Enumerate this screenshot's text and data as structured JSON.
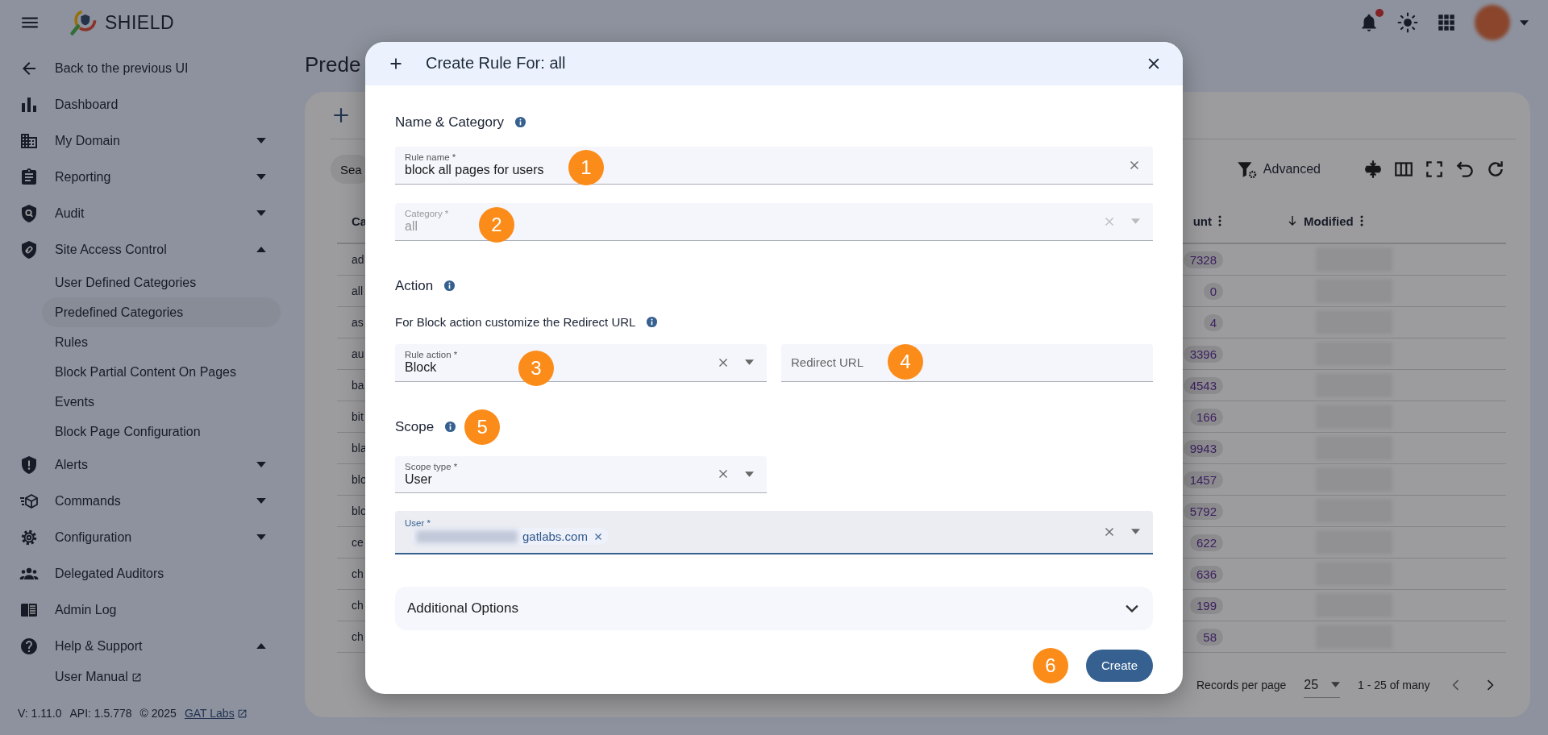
{
  "top_bar": {
    "app_name": "SHIELD",
    "notification_dot": true
  },
  "sidebar": {
    "back_link": "Back to the previous UI",
    "items": [
      {
        "label": "Dashboard"
      },
      {
        "label": "My Domain",
        "expanded": false
      },
      {
        "label": "Reporting",
        "expanded": false
      },
      {
        "label": "Audit",
        "expanded": false
      },
      {
        "label": "Site Access Control",
        "expanded": true,
        "children": [
          {
            "label": "User Defined Categories",
            "selected": false
          },
          {
            "label": "Predefined Categories",
            "selected": true
          },
          {
            "label": "Rules",
            "selected": false
          },
          {
            "label": "Block Partial Content On Pages",
            "selected": false
          },
          {
            "label": "Events",
            "selected": false
          },
          {
            "label": "Block Page Configuration",
            "selected": false
          }
        ]
      },
      {
        "label": "Alerts",
        "expanded": false
      },
      {
        "label": "Commands",
        "expanded": false
      },
      {
        "label": "Configuration",
        "expanded": false
      },
      {
        "label": "Delegated Auditors"
      },
      {
        "label": "Admin Log"
      },
      {
        "label": "Help & Support",
        "expanded": true,
        "children": [
          {
            "label": "User Manual",
            "selected": false,
            "external": true
          }
        ]
      }
    ],
    "footer": {
      "version": "V: 1.11.0",
      "api": "API: 1.5.778",
      "copyright": "© 2025",
      "link": "GAT Labs"
    }
  },
  "page": {
    "title": "Prede",
    "search_placeholder": "Sea",
    "advanced_button": "Advanced",
    "table": {
      "columns": [
        {
          "label": "Ca"
        },
        {
          "label": "unt"
        },
        {
          "label": "Modified",
          "sort_descending": true
        }
      ],
      "rows": [
        {
          "cells": [
            "ad",
            "7328"
          ]
        },
        {
          "cells": [
            "all",
            "0"
          ]
        },
        {
          "cells": [
            "as",
            "4"
          ]
        },
        {
          "cells": [
            "au",
            "3396"
          ]
        },
        {
          "cells": [
            "ba",
            "4543"
          ]
        },
        {
          "cells": [
            "bit",
            "166"
          ]
        },
        {
          "cells": [
            "bla",
            "9943"
          ]
        },
        {
          "cells": [
            "blo",
            "1457"
          ]
        },
        {
          "cells": [
            "blo",
            "5792"
          ]
        },
        {
          "cells": [
            "ce",
            "622"
          ]
        },
        {
          "cells": [
            "ch",
            "636"
          ]
        },
        {
          "cells": [
            "ch",
            "199"
          ]
        },
        {
          "cells": [
            "ch",
            "58"
          ]
        }
      ]
    },
    "pagination": {
      "label": "Records per page",
      "per_page": "25",
      "range": "1 - 25 of many"
    }
  },
  "dialog": {
    "title": "Create Rule For: all",
    "sections": [
      {
        "heading": "Name & Category",
        "fields": [
          {
            "label": "Rule name *",
            "value": "block all pages for users",
            "kind": "text",
            "clearable": true,
            "disabled": false,
            "marker": "1"
          },
          {
            "label": "Category *",
            "value": "all",
            "kind": "select",
            "clearable": true,
            "disabled": true,
            "marker": "2"
          }
        ]
      },
      {
        "heading": "Action",
        "note": "For Block action customize the Redirect URL",
        "fields": [
          {
            "label": "Rule action *",
            "value": "Block",
            "kind": "select",
            "clearable": true,
            "disabled": false,
            "marker": "3"
          },
          {
            "placeholder": "Redirect URL",
            "kind": "text",
            "clearable": false,
            "disabled": false,
            "marker": "4"
          }
        ]
      },
      {
        "heading": "Scope",
        "marker": "5",
        "fields": [
          {
            "label": "Scope type *",
            "value": "User",
            "kind": "select",
            "clearable": true,
            "disabled": false
          },
          {
            "label": "User *",
            "kind": "chips",
            "chips": [
              "gatlabs.com"
            ],
            "clearable": true,
            "disabled": false,
            "focused": true
          }
        ]
      }
    ],
    "additional_options": {
      "label": "Additional Options",
      "expanded": false
    },
    "create_button": "Create",
    "button_marker": "6"
  }
}
